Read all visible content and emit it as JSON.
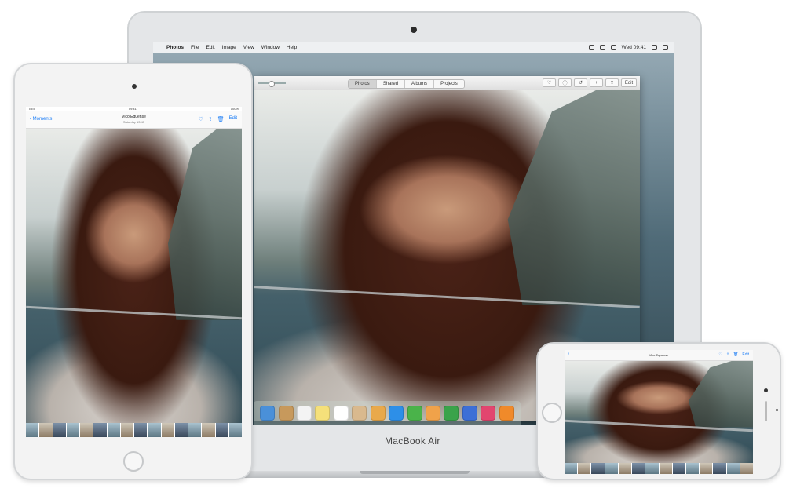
{
  "mac": {
    "label": "MacBook Air",
    "menubar": {
      "app": "Photos",
      "items": [
        "File",
        "Edit",
        "Image",
        "View",
        "Window",
        "Help"
      ],
      "clock": "Wed 09:41"
    },
    "tabs": [
      "Photos",
      "Shared",
      "Albums",
      "Projects"
    ],
    "active_tab": "Photos",
    "tools": {
      "heart": "♡",
      "info": "ⓘ",
      "rotate": "↺",
      "add": "+",
      "share": "⇪",
      "edit": "Edit"
    },
    "dock_icons": [
      {
        "name": "finder-icon",
        "color": "#4a90d9"
      },
      {
        "name": "contacts-icon",
        "color": "#c7995c"
      },
      {
        "name": "calendar-icon",
        "color": "#f4f4f4"
      },
      {
        "name": "notes-icon",
        "color": "#f5e07a"
      },
      {
        "name": "reminders-icon",
        "color": "#ffffff"
      },
      {
        "name": "photo-booth-icon",
        "color": "#d9b98e"
      },
      {
        "name": "photos-icon",
        "color": "#e9a94b"
      },
      {
        "name": "facetime-icon",
        "color": "#2d8fe8"
      },
      {
        "name": "messages-icon",
        "color": "#4ab34a"
      },
      {
        "name": "pages-icon",
        "color": "#f0a24a"
      },
      {
        "name": "numbers-icon",
        "color": "#3aa34a"
      },
      {
        "name": "keynote-icon",
        "color": "#3d6fd6"
      },
      {
        "name": "itunes-icon",
        "color": "#e2466f"
      },
      {
        "name": "ibooks-icon",
        "color": "#f08a2a"
      }
    ]
  },
  "ipad": {
    "status_time": "09:41",
    "status_battery": "100%",
    "back_label": "Moments",
    "title": "Vico Equense",
    "subtitle": "Saturday 13:45",
    "actions": {
      "heart": "♡",
      "share": "⇪",
      "trash": "🗑"
    },
    "edit": "Edit"
  },
  "iphone": {
    "back_label": "‹",
    "title": "Vico Equense",
    "actions": {
      "heart": "♡",
      "share": "⇪",
      "trash": "🗑"
    },
    "edit": "Edit"
  }
}
